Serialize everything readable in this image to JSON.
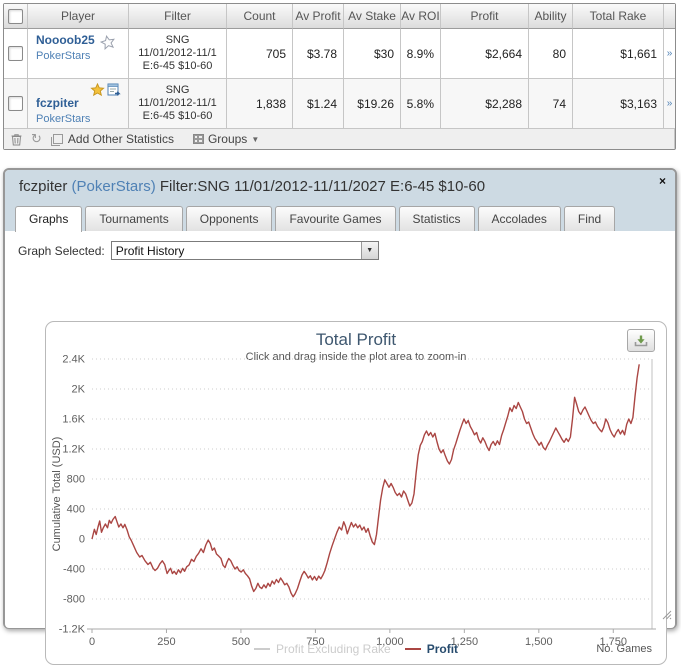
{
  "table": {
    "headers": [
      "Player",
      "Filter",
      "Count",
      "Av Profit",
      "Av Stake",
      "Av ROI",
      "Profit",
      "Ability",
      "Total Rake"
    ],
    "rows": [
      {
        "player": "Noooob25",
        "site": "PokerStars",
        "icons": [
          "star-outline"
        ],
        "filter_lines": [
          "SNG",
          "11/01/2012-11/1",
          "E:6-45 $10-60"
        ],
        "count": "705",
        "av_profit": "$3.78",
        "av_stake": "$30",
        "av_roi": "8.9%",
        "profit": "$2,664",
        "ability": "80",
        "total_rake": "$1,661",
        "row_link": "»"
      },
      {
        "player": "fczpiter",
        "site": "PokerStars",
        "icons": [
          "star-gold",
          "export-schedule"
        ],
        "filter_lines": [
          "SNG",
          "11/01/2012-11/1",
          "E:6-45 $10-60"
        ],
        "count": "1,838",
        "av_profit": "$1.24",
        "av_stake": "$19.26",
        "av_roi": "5.8%",
        "profit": "$2,288",
        "ability": "74",
        "total_rake": "$3,163",
        "row_link": "»"
      }
    ],
    "footer": {
      "add_stats_label": "Add Other Statistics",
      "groups_label": "Groups"
    }
  },
  "popup": {
    "title_player": "fczpiter",
    "title_site": "(PokerStars)",
    "title_rest": "Filter:SNG 11/01/2012-11/11/2027 E:6-45 $10-60",
    "close_label": "×",
    "tabs": [
      {
        "label": "Graphs",
        "active": true
      },
      {
        "label": "Tournaments",
        "active": false
      },
      {
        "label": "Opponents",
        "active": false
      },
      {
        "label": "Favourite Games",
        "active": false
      },
      {
        "label": "Statistics",
        "active": false
      },
      {
        "label": "Accolades",
        "active": false
      },
      {
        "label": "Find",
        "active": false
      }
    ],
    "graph_selected_label": "Graph Selected:",
    "graph_selected_value": "Profit History"
  },
  "chart_data": {
    "type": "line",
    "title": "Total Profit",
    "subtitle": "Click and drag inside the plot area to zoom-in",
    "ylabel": "Cumulative Total (USD)",
    "xlabel": "No. Games",
    "xlim": [
      0,
      1880
    ],
    "ylim": [
      -1200,
      2400
    ],
    "grid": "dotted-horizontal",
    "legend_position": "bottom-center",
    "x_ticks": [
      {
        "v": 0,
        "label": "0"
      },
      {
        "v": 250,
        "label": "250"
      },
      {
        "v": 500,
        "label": "500"
      },
      {
        "v": 750,
        "label": "750"
      },
      {
        "v": 1000,
        "label": "1,000"
      },
      {
        "v": 1250,
        "label": "1,250"
      },
      {
        "v": 1500,
        "label": "1,500"
      },
      {
        "v": 1750,
        "label": "1,750"
      }
    ],
    "y_ticks": [
      {
        "v": 2400,
        "label": "2.4K"
      },
      {
        "v": 2000,
        "label": "2K"
      },
      {
        "v": 1600,
        "label": "1.6K"
      },
      {
        "v": 1200,
        "label": "1.2K"
      },
      {
        "v": 800,
        "label": "800"
      },
      {
        "v": 400,
        "label": "400"
      },
      {
        "v": 0,
        "label": "0"
      },
      {
        "v": -400,
        "label": "-400"
      },
      {
        "v": -800,
        "label": "-800"
      },
      {
        "v": -1200,
        "label": "-1.2K"
      }
    ],
    "legend": [
      {
        "name": "Profit Excluding Rake",
        "color": "#cccccc",
        "disabled": true
      },
      {
        "name": "Profit",
        "color": "#AA4643",
        "disabled": false
      }
    ],
    "series": [
      {
        "name": "Profit",
        "color": "#AA4643",
        "points": [
          [
            0,
            0
          ],
          [
            8,
            130
          ],
          [
            14,
            60
          ],
          [
            20,
            160
          ],
          [
            26,
            240
          ],
          [
            32,
            90
          ],
          [
            38,
            150
          ],
          [
            45,
            200
          ],
          [
            52,
            150
          ],
          [
            58,
            250
          ],
          [
            64,
            210
          ],
          [
            70,
            260
          ],
          [
            78,
            300
          ],
          [
            84,
            230
          ],
          [
            90,
            160
          ],
          [
            97,
            200
          ],
          [
            104,
            150
          ],
          [
            110,
            195
          ],
          [
            118,
            120
          ],
          [
            125,
            30
          ],
          [
            132,
            -20
          ],
          [
            140,
            -90
          ],
          [
            150,
            -180
          ],
          [
            160,
            -240
          ],
          [
            168,
            -220
          ],
          [
            178,
            -290
          ],
          [
            188,
            -340
          ],
          [
            196,
            -310
          ],
          [
            205,
            -390
          ],
          [
            212,
            -420
          ],
          [
            220,
            -390
          ],
          [
            228,
            -330
          ],
          [
            236,
            -290
          ],
          [
            244,
            -340
          ],
          [
            252,
            -460
          ],
          [
            258,
            -420
          ],
          [
            264,
            -390
          ],
          [
            270,
            -460
          ],
          [
            276,
            -430
          ],
          [
            283,
            -470
          ],
          [
            290,
            -410
          ],
          [
            297,
            -450
          ],
          [
            304,
            -390
          ],
          [
            311,
            -430
          ],
          [
            318,
            -370
          ],
          [
            326,
            -345
          ],
          [
            334,
            -270
          ],
          [
            342,
            -300
          ],
          [
            350,
            -230
          ],
          [
            358,
            -190
          ],
          [
            366,
            -130
          ],
          [
            374,
            -180
          ],
          [
            382,
            -80
          ],
          [
            390,
            -15
          ],
          [
            397,
            -60
          ],
          [
            404,
            -150
          ],
          [
            411,
            -120
          ],
          [
            418,
            -200
          ],
          [
            426,
            -230
          ],
          [
            433,
            -260
          ],
          [
            440,
            -350
          ],
          [
            447,
            -380
          ],
          [
            453,
            -310
          ],
          [
            459,
            -260
          ],
          [
            466,
            -290
          ],
          [
            473,
            -350
          ],
          [
            480,
            -400
          ],
          [
            487,
            -370
          ],
          [
            494,
            -420
          ],
          [
            501,
            -440
          ],
          [
            508,
            -410
          ],
          [
            515,
            -460
          ],
          [
            522,
            -490
          ],
          [
            529,
            -530
          ],
          [
            536,
            -630
          ],
          [
            543,
            -700
          ],
          [
            550,
            -660
          ],
          [
            557,
            -590
          ],
          [
            563,
            -640
          ],
          [
            570,
            -660
          ],
          [
            577,
            -610
          ],
          [
            584,
            -650
          ],
          [
            591,
            -590
          ],
          [
            598,
            -630
          ],
          [
            605,
            -560
          ],
          [
            612,
            -600
          ],
          [
            619,
            -540
          ],
          [
            626,
            -580
          ],
          [
            633,
            -520
          ],
          [
            640,
            -560
          ],
          [
            647,
            -610
          ],
          [
            654,
            -590
          ],
          [
            661,
            -640
          ],
          [
            668,
            -720
          ],
          [
            675,
            -770
          ],
          [
            682,
            -730
          ],
          [
            690,
            -660
          ],
          [
            698,
            -560
          ],
          [
            705,
            -480
          ],
          [
            712,
            -430
          ],
          [
            719,
            -470
          ],
          [
            726,
            -520
          ],
          [
            733,
            -490
          ],
          [
            740,
            -545
          ],
          [
            747,
            -500
          ],
          [
            754,
            -550
          ],
          [
            761,
            -495
          ],
          [
            768,
            -530
          ],
          [
            775,
            -480
          ],
          [
            782,
            -420
          ],
          [
            790,
            -310
          ],
          [
            798,
            -190
          ],
          [
            806,
            -90
          ],
          [
            814,
            0
          ],
          [
            822,
            90
          ],
          [
            830,
            160
          ],
          [
            838,
            120
          ],
          [
            845,
            230
          ],
          [
            851,
            170
          ],
          [
            857,
            70
          ],
          [
            864,
            150
          ],
          [
            871,
            220
          ],
          [
            878,
            160
          ],
          [
            885,
            200
          ],
          [
            892,
            150
          ],
          [
            899,
            185
          ],
          [
            906,
            120
          ],
          [
            913,
            160
          ],
          [
            920,
            90
          ],
          [
            927,
            140
          ],
          [
            934,
            40
          ],
          [
            941,
            -40
          ],
          [
            948,
            -75
          ],
          [
            955,
            60
          ],
          [
            962,
            300
          ],
          [
            969,
            520
          ],
          [
            976,
            680
          ],
          [
            983,
            790
          ],
          [
            990,
            740
          ],
          [
            997,
            690
          ],
          [
            1004,
            740
          ],
          [
            1011,
            690
          ],
          [
            1018,
            620
          ],
          [
            1025,
            580
          ],
          [
            1032,
            610
          ],
          [
            1039,
            560
          ],
          [
            1046,
            640
          ],
          [
            1053,
            600
          ],
          [
            1060,
            520
          ],
          [
            1067,
            440
          ],
          [
            1074,
            480
          ],
          [
            1081,
            600
          ],
          [
            1088,
            880
          ],
          [
            1095,
            1120
          ],
          [
            1102,
            1250
          ],
          [
            1109,
            1300
          ],
          [
            1116,
            1390
          ],
          [
            1123,
            1440
          ],
          [
            1130,
            1380
          ],
          [
            1137,
            1420
          ],
          [
            1144,
            1360
          ],
          [
            1151,
            1410
          ],
          [
            1158,
            1300
          ],
          [
            1165,
            1200
          ],
          [
            1172,
            1150
          ],
          [
            1179,
            1190
          ],
          [
            1186,
            1110
          ],
          [
            1193,
            1040
          ],
          [
            1200,
            1000
          ],
          [
            1207,
            1060
          ],
          [
            1214,
            1190
          ],
          [
            1221,
            1270
          ],
          [
            1228,
            1360
          ],
          [
            1235,
            1450
          ],
          [
            1242,
            1530
          ],
          [
            1249,
            1600
          ],
          [
            1256,
            1540
          ],
          [
            1263,
            1580
          ],
          [
            1270,
            1500
          ],
          [
            1277,
            1450
          ],
          [
            1284,
            1390
          ],
          [
            1291,
            1420
          ],
          [
            1298,
            1330
          ],
          [
            1305,
            1280
          ],
          [
            1312,
            1350
          ],
          [
            1319,
            1300
          ],
          [
            1326,
            1230
          ],
          [
            1333,
            1180
          ],
          [
            1340,
            1260
          ],
          [
            1347,
            1300
          ],
          [
            1354,
            1250
          ],
          [
            1361,
            1310
          ],
          [
            1368,
            1260
          ],
          [
            1375,
            1380
          ],
          [
            1382,
            1460
          ],
          [
            1389,
            1550
          ],
          [
            1396,
            1640
          ],
          [
            1403,
            1750
          ],
          [
            1410,
            1700
          ],
          [
            1417,
            1780
          ],
          [
            1424,
            1740
          ],
          [
            1431,
            1820
          ],
          [
            1438,
            1760
          ],
          [
            1445,
            1700
          ],
          [
            1452,
            1600
          ],
          [
            1459,
            1540
          ],
          [
            1466,
            1560
          ],
          [
            1473,
            1480
          ],
          [
            1480,
            1400
          ],
          [
            1487,
            1340
          ],
          [
            1494,
            1300
          ],
          [
            1501,
            1250
          ],
          [
            1508,
            1290
          ],
          [
            1515,
            1220
          ],
          [
            1522,
            1190
          ],
          [
            1529,
            1250
          ],
          [
            1536,
            1300
          ],
          [
            1543,
            1360
          ],
          [
            1550,
            1420
          ],
          [
            1557,
            1480
          ],
          [
            1564,
            1430
          ],
          [
            1571,
            1380
          ],
          [
            1578,
            1330
          ],
          [
            1585,
            1290
          ],
          [
            1592,
            1340
          ],
          [
            1599,
            1300
          ],
          [
            1606,
            1360
          ],
          [
            1613,
            1600
          ],
          [
            1620,
            1890
          ],
          [
            1627,
            1800
          ],
          [
            1634,
            1700
          ],
          [
            1641,
            1660
          ],
          [
            1648,
            1720
          ],
          [
            1655,
            1760
          ],
          [
            1662,
            1700
          ],
          [
            1669,
            1640
          ],
          [
            1676,
            1580
          ],
          [
            1683,
            1540
          ],
          [
            1690,
            1560
          ],
          [
            1697,
            1500
          ],
          [
            1704,
            1460
          ],
          [
            1711,
            1430
          ],
          [
            1718,
            1490
          ],
          [
            1725,
            1600
          ],
          [
            1732,
            1550
          ],
          [
            1739,
            1460
          ],
          [
            1746,
            1400
          ],
          [
            1753,
            1360
          ],
          [
            1760,
            1420
          ],
          [
            1767,
            1460
          ],
          [
            1774,
            1400
          ],
          [
            1781,
            1450
          ],
          [
            1788,
            1390
          ],
          [
            1795,
            1530
          ],
          [
            1802,
            1600
          ],
          [
            1809,
            1540
          ],
          [
            1816,
            1620
          ],
          [
            1823,
            1900
          ],
          [
            1830,
            2150
          ],
          [
            1837,
            2330
          ]
        ]
      }
    ]
  }
}
